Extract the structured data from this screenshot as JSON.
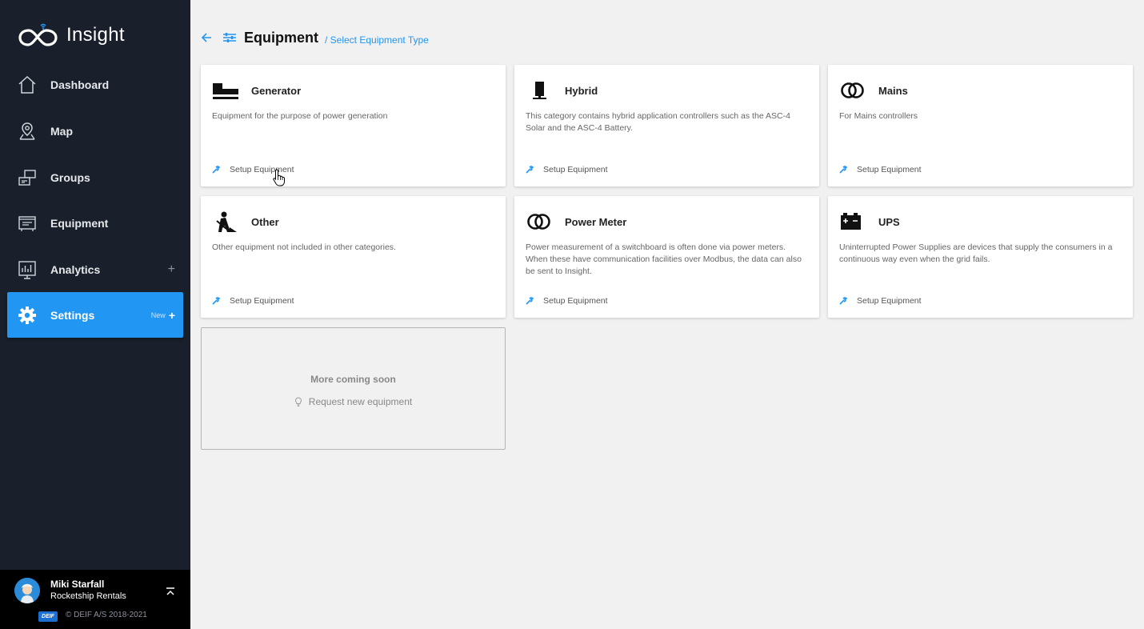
{
  "app": {
    "name": "Insight"
  },
  "sidebar": {
    "items": [
      {
        "label": "Dashboard",
        "icon": "home-icon"
      },
      {
        "label": "Map",
        "icon": "map-pin-icon"
      },
      {
        "label": "Groups",
        "icon": "groups-icon"
      },
      {
        "label": "Equipment",
        "icon": "equipment-icon"
      },
      {
        "label": "Analytics",
        "icon": "analytics-icon",
        "expand": "+"
      },
      {
        "label": "Settings",
        "icon": "gear-icon",
        "badge": "New",
        "expand": "+",
        "active": true
      }
    ]
  },
  "user": {
    "name": "Miki Starfall",
    "organization": "Rocketship Rentals",
    "company_logo": "DEIF",
    "copyright": "© DEIF A/S 2018-2021"
  },
  "header": {
    "title": "Equipment",
    "breadcrumb": "/ Select Equipment Type"
  },
  "cards": [
    {
      "title": "Generator",
      "icon": "generator-icon",
      "description": "Equipment for the purpose of power generation",
      "action": "Setup Equipment"
    },
    {
      "title": "Hybrid",
      "icon": "hybrid-icon",
      "description": "This category contains hybrid application controllers such as the ASC-4 Solar and the ASC-4 Battery.",
      "action": "Setup Equipment"
    },
    {
      "title": "Mains",
      "icon": "mains-icon",
      "description": "For Mains controllers",
      "action": "Setup Equipment"
    },
    {
      "title": "Other",
      "icon": "worker-icon",
      "description": "Other equipment not included in other categories.",
      "action": "Setup Equipment"
    },
    {
      "title": "Power Meter",
      "icon": "power-meter-icon",
      "description": "Power measurement of a switchboard is often done via power meters. When these have communication facilities over Modbus, the data can also be sent to Insight.",
      "action": "Setup Equipment"
    },
    {
      "title": "UPS",
      "icon": "battery-icon",
      "description": "Uninterrupted Power Supplies are devices that supply the consumers in a continuous way even when the grid fails.",
      "action": "Setup Equipment"
    }
  ],
  "coming_soon": {
    "title": "More coming soon",
    "link": "Request new equipment"
  },
  "colors": {
    "sidebar_bg": "#19202b",
    "accent": "#2196f3",
    "page_bg": "#f1f1f1"
  }
}
